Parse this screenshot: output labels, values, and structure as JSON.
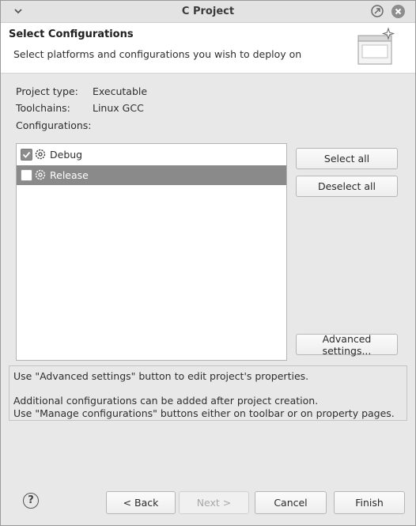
{
  "window": {
    "title": "C Project"
  },
  "header": {
    "heading": "Select Configurations",
    "description": "Select platforms and configurations you wish to deploy on"
  },
  "info": {
    "project_type_label": "Project type:",
    "project_type_value": "Executable",
    "toolchains_label": "Toolchains:",
    "toolchains_value": "Linux GCC",
    "configurations_label": "Configurations:"
  },
  "configurations": [
    {
      "label": "Debug",
      "checked": true,
      "selected": false
    },
    {
      "label": "Release",
      "checked": false,
      "selected": true
    }
  ],
  "side_buttons": {
    "select_all": "Select all",
    "deselect_all": "Deselect all",
    "advanced_settings": "Advanced settings..."
  },
  "messages": {
    "line1": "Use \"Advanced settings\" button to edit project's properties.",
    "line2": "Additional configurations can be added after project creation.",
    "line3": "Use \"Manage configurations\" buttons either on toolbar or on property pages."
  },
  "footer": {
    "help_glyph": "?",
    "back": "< Back",
    "next": "Next >",
    "cancel": "Cancel",
    "finish": "Finish"
  }
}
